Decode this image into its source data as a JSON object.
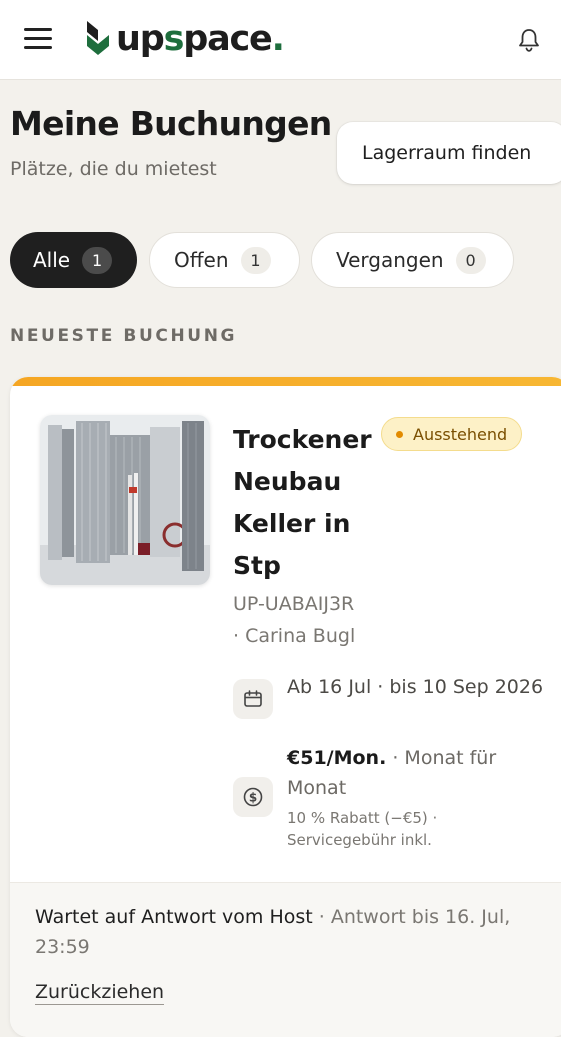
{
  "header": {
    "logo_text_up": "up",
    "logo_text_s": "s",
    "logo_text_pace": "pace",
    "logo_dot": ".",
    "menu_icon": "hamburger-menu-icon",
    "notification_icon": "bell-icon",
    "brand_color": "#1e6e3d"
  },
  "page": {
    "title": "Meine Buchungen",
    "subtitle": "Plätze, die du mietest",
    "find_button": "Lagerraum finden"
  },
  "filters": [
    {
      "label": "Alle",
      "count": "1",
      "active": true
    },
    {
      "label": "Offen",
      "count": "1",
      "active": false
    },
    {
      "label": "Vergangen",
      "count": "0",
      "active": false
    }
  ],
  "section_label": "NEUESTE BUCHUNG",
  "booking": {
    "title": "Trockener Neubau Keller in Stp",
    "status": "Ausstehend",
    "reference": "UP-UABAIJ3R",
    "host": "· Carina Bugl",
    "dates": "Ab 16 Jul · bis 10 Sep 2026",
    "price": "€51/Mon.",
    "price_suffix": " · Monat für Monat",
    "price_note": "10 % Rabatt (−€5) · Servicegebühr inkl.",
    "calendar_icon": "calendar-icon",
    "price_icon": "dollar-circle-icon",
    "awaiting_strong": "Wartet auf Antwort vom Host",
    "awaiting_rest": " · Antwort bis 16. Jul, 23:59",
    "withdraw_label": "Zurückziehen",
    "accent_color": "#f5a623",
    "status_color": "#e28b00"
  }
}
